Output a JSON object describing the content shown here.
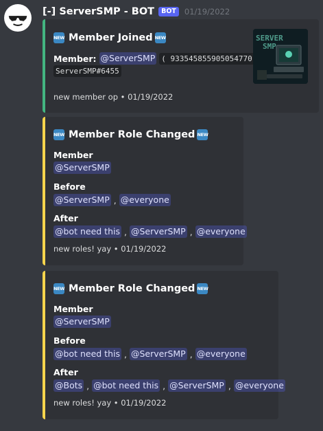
{
  "message": {
    "author": "[-] ServerSMP - BOT",
    "bot_tag": "BOT",
    "timestamp": "01/19/2022"
  },
  "new_badge": "NEW",
  "embed_join": {
    "title": "Member Joined",
    "member_label": "Member:",
    "member_mention": "@ServerSMP",
    "member_id": "( 933545855905054770 )",
    "member_tag": "ServerSMP#6455",
    "footer": "new member op • 01/19/2022",
    "accent_color": "#43b581",
    "thumbnail_text": "SERVER SMP"
  },
  "embed_role1": {
    "title": "Member Role Changed",
    "member_label": "Member",
    "member_mention": "@ServerSMP",
    "before_label": "Before",
    "before_roles": [
      "@ServerSMP",
      "@everyone"
    ],
    "after_label": "After",
    "after_roles": [
      "@bot need this",
      "@ServerSMP",
      "@everyone"
    ],
    "footer": "new roles! yay • 01/19/2022",
    "accent_color": "#f6d44c"
  },
  "embed_role2": {
    "title": "Member Role Changed",
    "member_label": "Member",
    "member_mention": "@ServerSMP",
    "before_label": "Before",
    "before_roles": [
      "@bot need this",
      "@ServerSMP",
      "@everyone"
    ],
    "after_label": "After",
    "after_roles": [
      "@Bots",
      "@bot need this",
      "@ServerSMP",
      "@everyone"
    ],
    "footer": "new roles! yay • 01/19/2022",
    "accent_color": "#f6d44c"
  },
  "separator": ","
}
